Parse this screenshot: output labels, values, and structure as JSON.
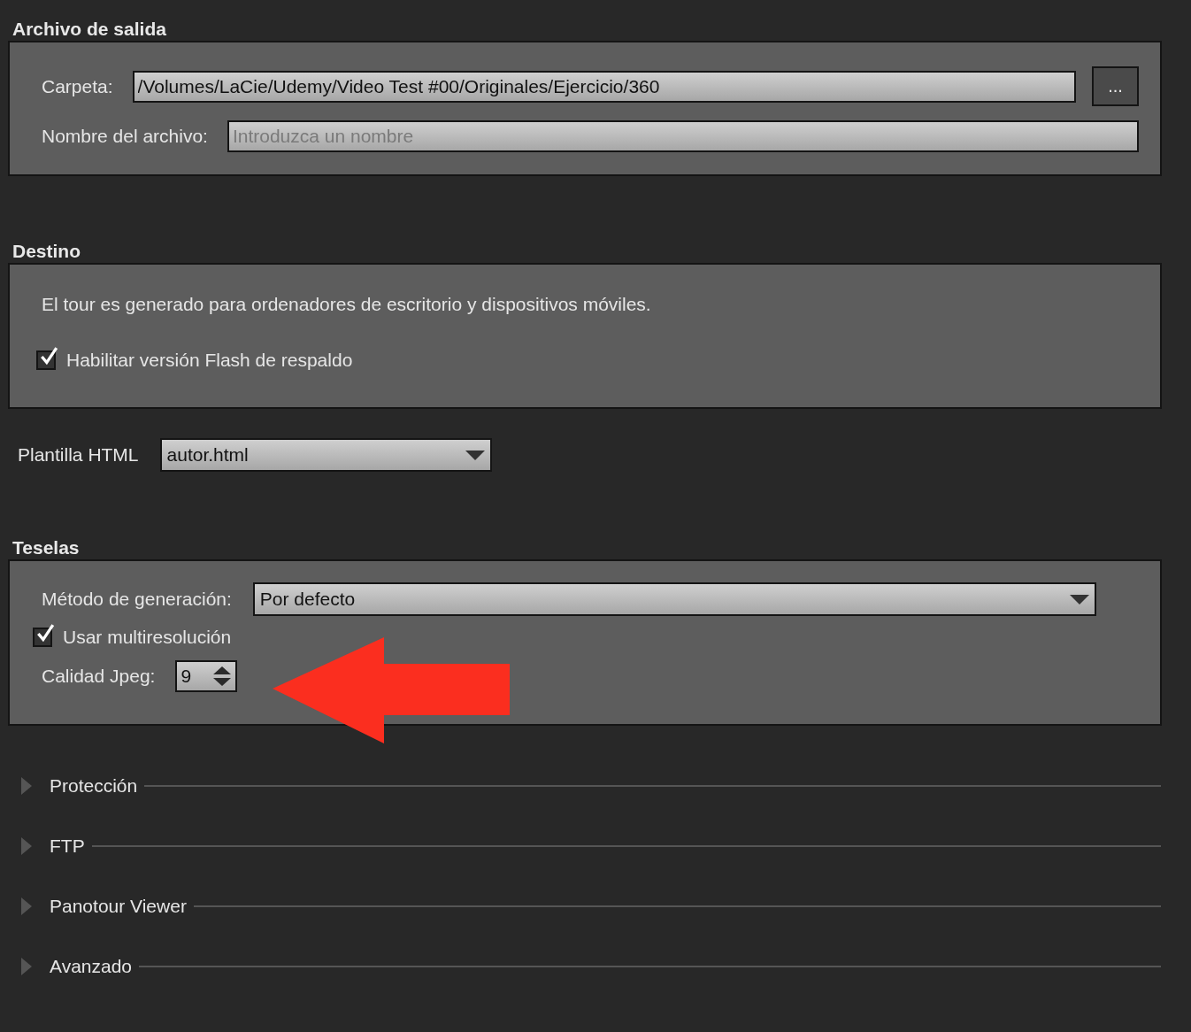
{
  "output_file": {
    "title": "Archivo de salida",
    "folder": {
      "label": "Carpeta:",
      "value": "/Volumes/LaCie/Udemy/Video Test #00/Originales/Ejercicio/360",
      "browse_button": "..."
    },
    "file_name": {
      "label": "Nombre del archivo:",
      "placeholder": "Introduzca un nombre"
    }
  },
  "destination": {
    "title": "Destino",
    "description": "El tour es generado para ordenadores de escritorio y dispositivos móviles.",
    "flash_fallback": {
      "label": "Habilitar versión Flash de respaldo",
      "checked": true
    }
  },
  "html_template": {
    "label": "Plantilla HTML",
    "value": "autor.html"
  },
  "tiles": {
    "title": "Teselas",
    "method": {
      "label": "Método de generación:",
      "value": "Por defecto"
    },
    "multiresolution": {
      "label": "Usar multiresolución",
      "checked": true
    },
    "jpeg_quality": {
      "label": "Calidad Jpeg:",
      "value": "9"
    }
  },
  "collapsed_sections": [
    {
      "title": "Protección",
      "expanded": false
    },
    {
      "title": "FTP",
      "expanded": false
    },
    {
      "title": "Panotour Viewer",
      "expanded": false
    },
    {
      "title": "Avanzado",
      "expanded": false
    }
  ]
}
